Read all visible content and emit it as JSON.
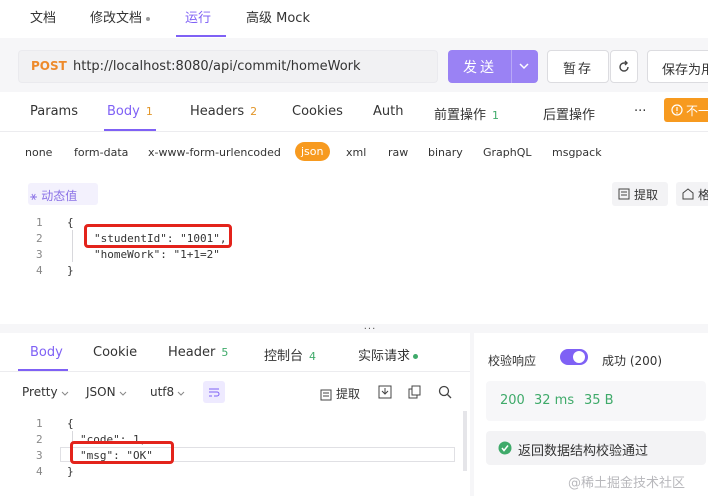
{
  "top_tabs": [
    {
      "label": "文档"
    },
    {
      "label": "修改文档"
    },
    {
      "label": "运行"
    },
    {
      "label": "高级 Mock"
    }
  ],
  "request": {
    "method": "POST",
    "url": "http://localhost:8080/api/commit/homeWork",
    "send_label": "发送",
    "save_label": "暂存",
    "save_as_label": "保存为用",
    "tabs": [
      {
        "label": "Params",
        "badge": ""
      },
      {
        "label": "Body",
        "badge": "1"
      },
      {
        "label": "Headers",
        "badge": "2"
      },
      {
        "label": "Cookies",
        "badge": ""
      },
      {
        "label": "Auth",
        "badge": ""
      },
      {
        "label": "前置操作",
        "badge": "1"
      },
      {
        "label": "后置操作",
        "badge": ""
      },
      {
        "label": "···",
        "badge": ""
      }
    ],
    "warn_label": "不一",
    "body_formats": [
      "none",
      "form-data",
      "x-www-form-urlencoded",
      "json",
      "xml",
      "raw",
      "binary",
      "GraphQL",
      "msgpack"
    ],
    "dynamic_value_label": "动态值",
    "extract_label": "提取",
    "format_label": "格",
    "code_lines": [
      {
        "n": "1",
        "text": "{"
      },
      {
        "n": "2",
        "text": "\"studentId\": \"1001\","
      },
      {
        "n": "3",
        "text": "\"homeWork\": \"1+1=2\""
      },
      {
        "n": "4",
        "text": "}"
      }
    ]
  },
  "resize_handle": "···",
  "response": {
    "tabs": [
      {
        "label": "Body",
        "badge": ""
      },
      {
        "label": "Cookie",
        "badge": ""
      },
      {
        "label": "Header",
        "badge": "5"
      },
      {
        "label": "控制台",
        "badge": "4"
      },
      {
        "label": "实际请求",
        "badge": ""
      }
    ],
    "view_mode": "Pretty",
    "format": "JSON",
    "encoding": "utf8",
    "extract_label": "提取",
    "code_lines": [
      {
        "n": "1",
        "text": "{"
      },
      {
        "n": "2",
        "text": "\"code\": 1,"
      },
      {
        "n": "3",
        "text": "\"msg\": \"OK\""
      },
      {
        "n": "4",
        "text": "}"
      }
    ]
  },
  "validation": {
    "label": "校验响应",
    "enabled": true,
    "status": "成功 (200)",
    "status_code": "200",
    "time": "32 ms",
    "size": "35 B",
    "result": "返回数据结构校验通过"
  },
  "watermark": "@稀土掘金技术社区",
  "colors": {
    "accent": "#7f61f5",
    "orange": "#f79a1f",
    "success": "#3faa6a",
    "highlight": "#e3231b"
  }
}
